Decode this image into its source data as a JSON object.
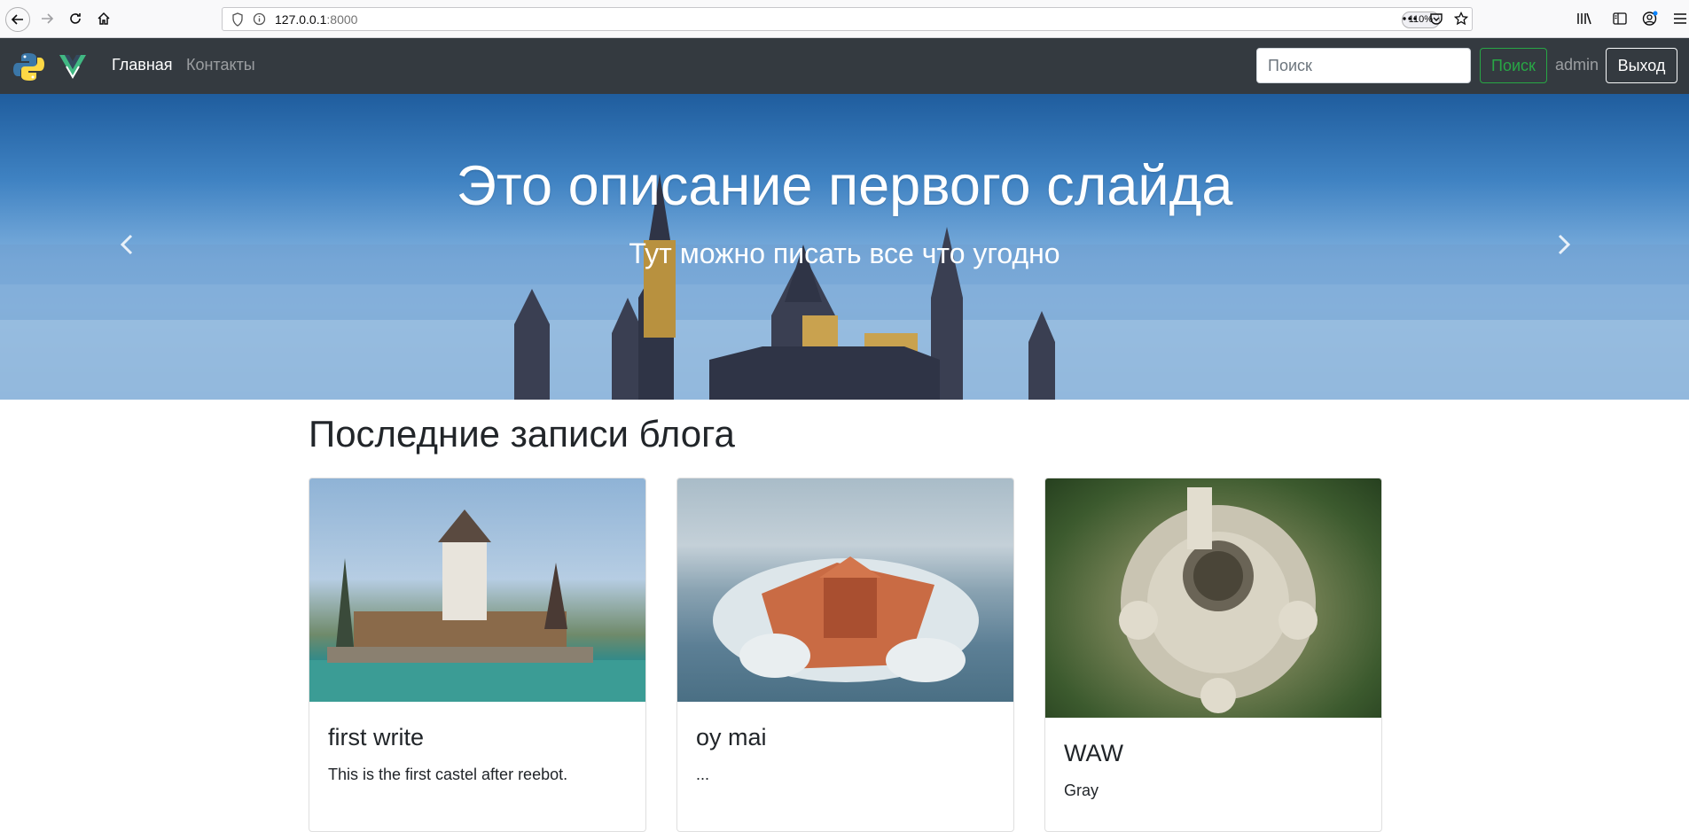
{
  "browser": {
    "url_host": "127.0.0.1",
    "url_port": ":8000",
    "zoom": "110%"
  },
  "navbar": {
    "home": "Главная",
    "contacts": "Контакты",
    "search_placeholder": "Поиск",
    "search_button": "Поиск",
    "user": "admin",
    "logout": "Выход"
  },
  "carousel": {
    "title": "Это описание первого слайда",
    "subtitle": "Тут можно писать все что угодно"
  },
  "main": {
    "section_title": "Последние записи блога",
    "cards": [
      {
        "title": "first write",
        "text": "This is the first castel after reebot."
      },
      {
        "title": "oy mai",
        "text": "..."
      },
      {
        "title": "WAW",
        "text": "Gray"
      }
    ]
  },
  "colors": {
    "navbar_bg": "#343a40",
    "success": "#28a745"
  }
}
